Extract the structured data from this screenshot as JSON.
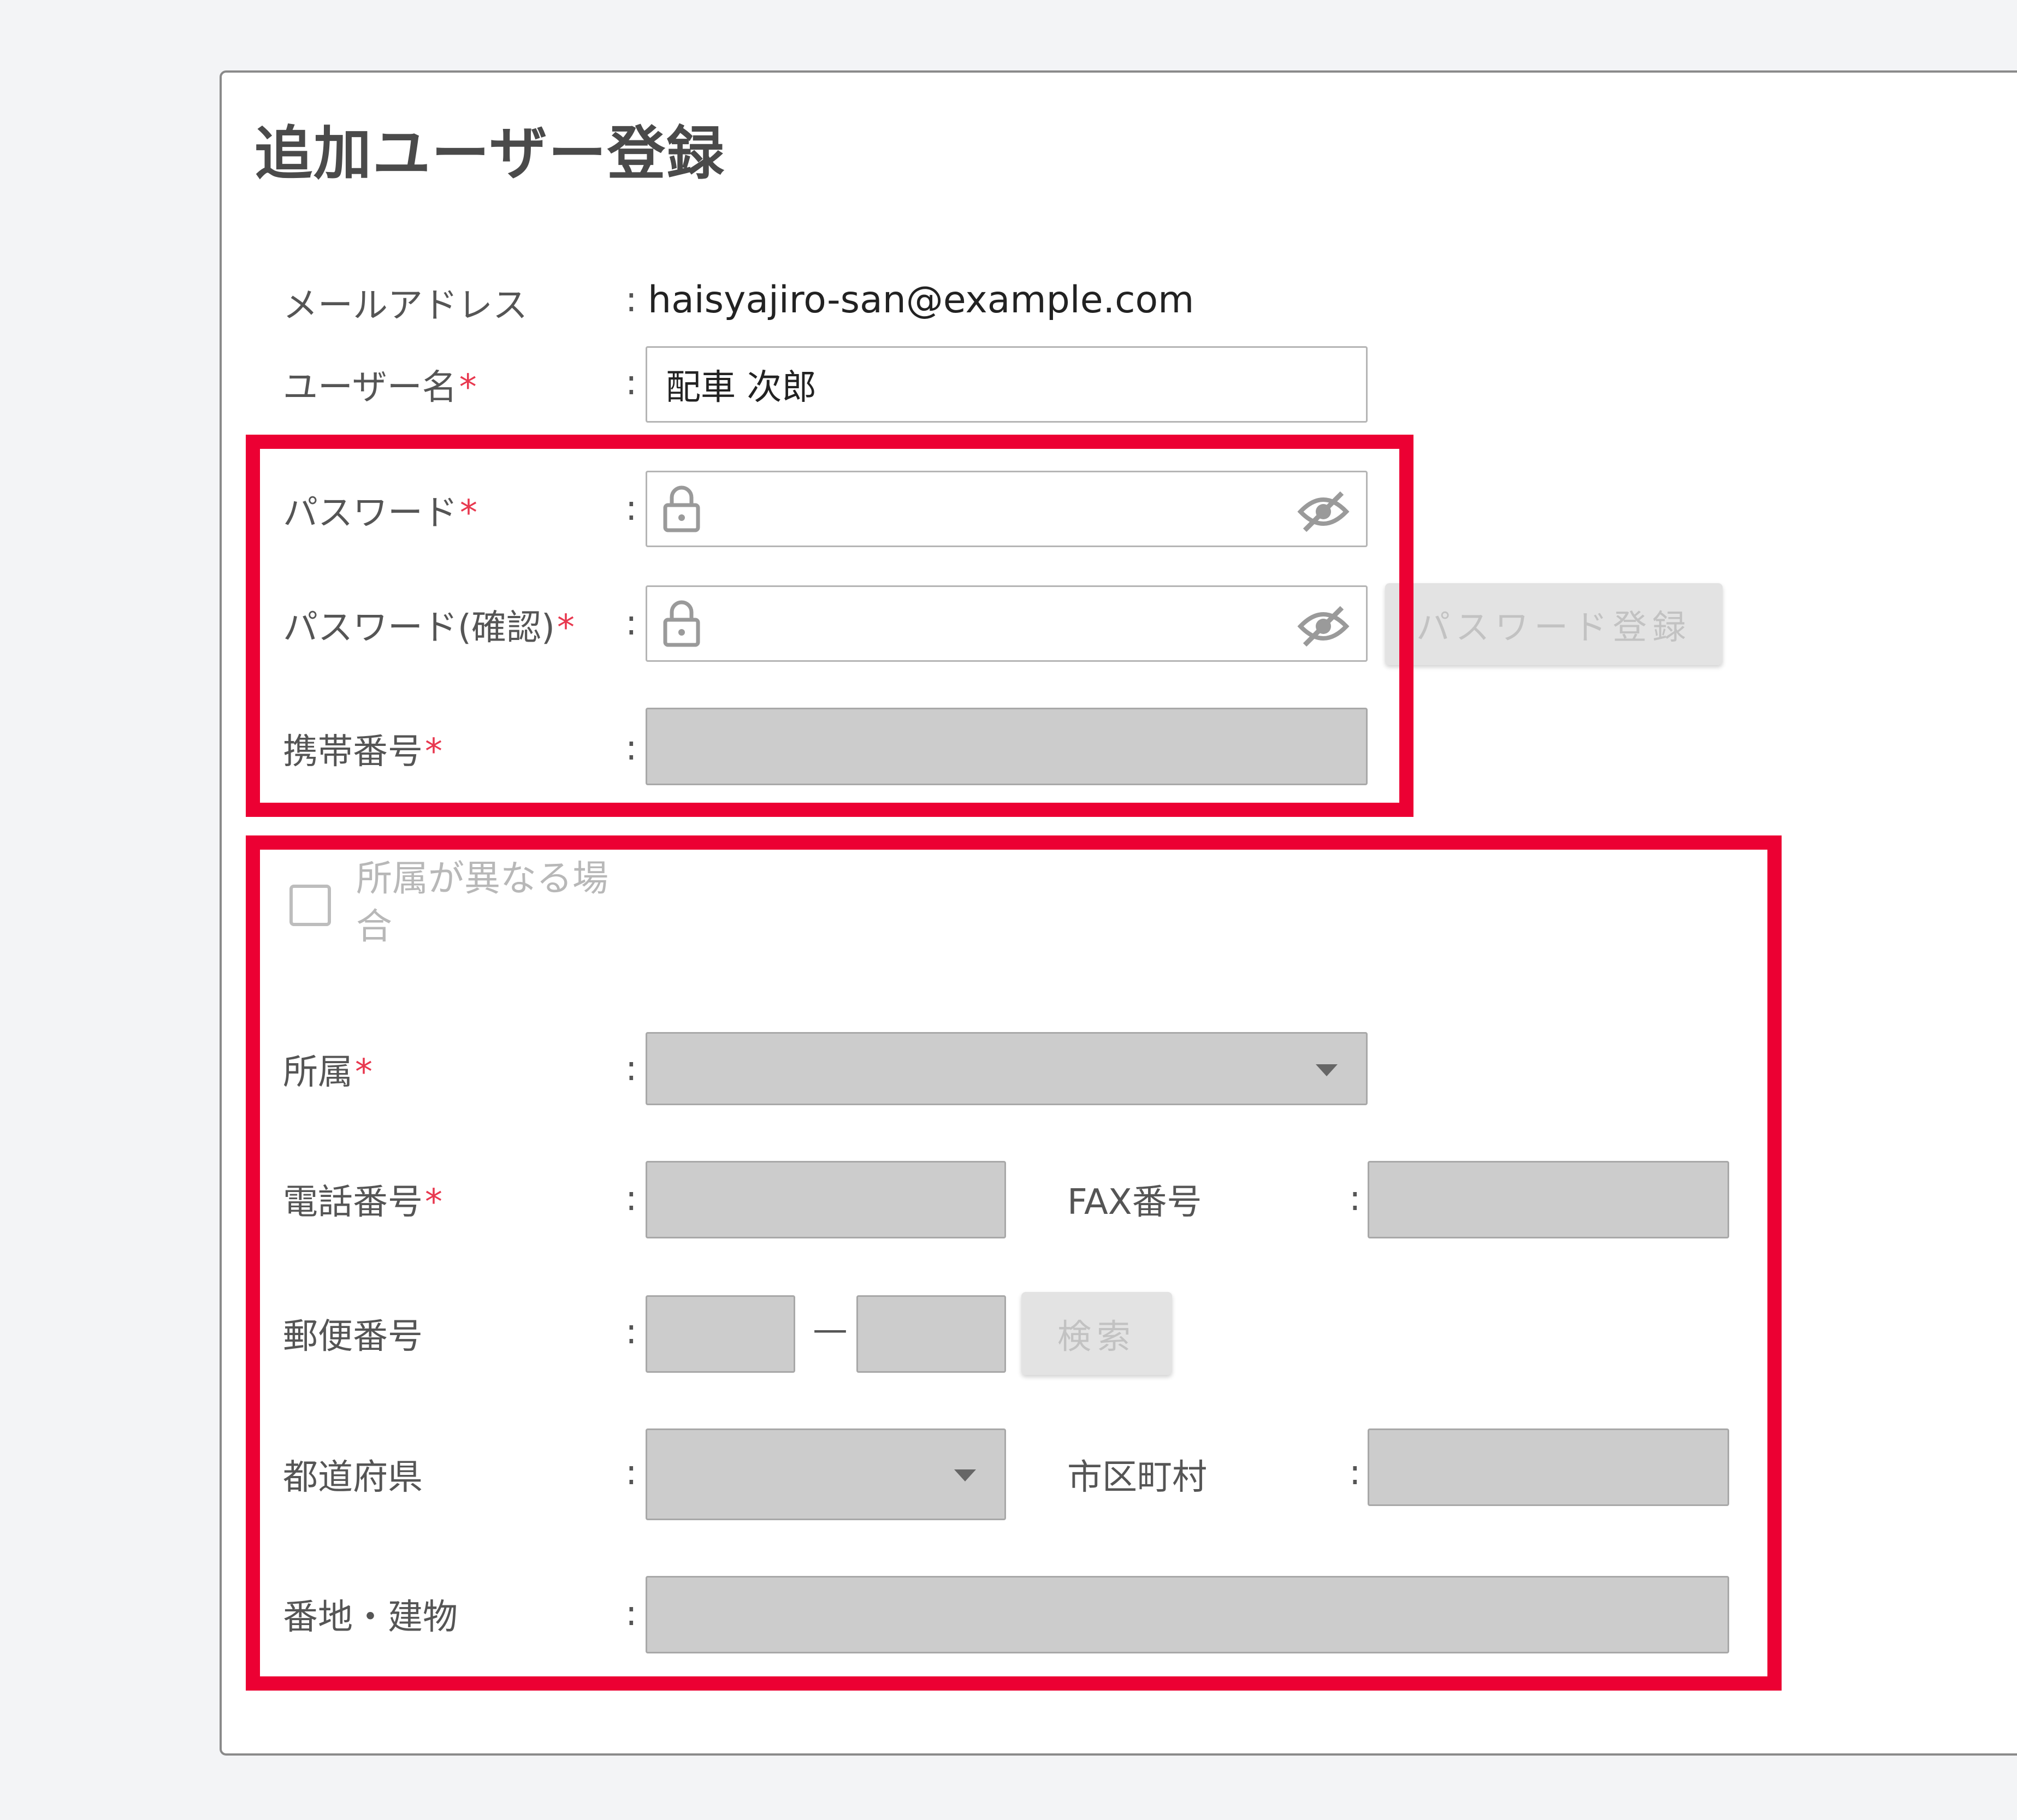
{
  "page_title": "追加ユーザー登録",
  "email": {
    "label": "メールアドレス",
    "value": "haisyajiro-san@example.com"
  },
  "username": {
    "label": "ユーザー名",
    "value": "配車 次郎"
  },
  "password": {
    "label": "パスワード"
  },
  "password_confirm": {
    "label": "パスワード(確認)"
  },
  "password_register_button": "パスワード登録",
  "mobile": {
    "label": "携帯番号"
  },
  "different_affiliation_checkbox": {
    "label": "所属が異なる場合",
    "checked": false
  },
  "affiliation": {
    "label": "所属"
  },
  "phone": {
    "label": "電話番号"
  },
  "fax": {
    "label": "FAX番号"
  },
  "postal_code": {
    "label": "郵便番号",
    "separator": "—"
  },
  "search_button": "検索",
  "prefecture": {
    "label": "都道府県"
  },
  "city": {
    "label": "市区町村"
  },
  "address": {
    "label": "番地・建物"
  },
  "required_mark": "*",
  "colon": ":",
  "colors": {
    "highlight": "#ec0033",
    "required": "#e8384f",
    "disabled_field": "#cccccc"
  }
}
